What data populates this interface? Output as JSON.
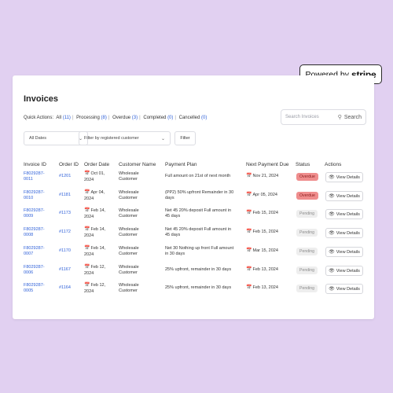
{
  "badge": {
    "prefix": "Powered by",
    "brand": "stripe"
  },
  "page": {
    "title": "Invoices"
  },
  "quick_actions": {
    "label": "Quick Actions:",
    "items": [
      {
        "name": "All",
        "count": "(11)"
      },
      {
        "name": "Processing",
        "count": "(8)"
      },
      {
        "name": "Overdue",
        "count": "(3)"
      },
      {
        "name": "Completed",
        "count": "(0)"
      },
      {
        "name": "Cancelled",
        "count": "(0)"
      }
    ]
  },
  "search": {
    "placeholder": "Search Invoices",
    "button": "Search"
  },
  "filters": {
    "dates": "All Dates",
    "customer": "Filter by registered customer",
    "button": "Filter"
  },
  "table": {
    "headers": [
      "Invoice ID",
      "Order ID",
      "Order Date",
      "Customer Name",
      "Payment Plan",
      "Next Payment Due",
      "Status",
      "Actions"
    ],
    "rows": [
      {
        "invoice_1": "F8029287-",
        "invoice_2": "0011",
        "order": "#1201",
        "date_1": "Oct 01,",
        "date_2": "2024",
        "cust_1": "Wholesale",
        "cust_2": "Customer",
        "plan_1": "Full amount on 21st of next month",
        "plan_2": "",
        "due": "Nov 21, 2024",
        "status": "Overdue",
        "status_type": "overdue",
        "action": "View Details"
      },
      {
        "invoice_1": "F8029287-",
        "invoice_2": "0010",
        "order": "#1181",
        "date_1": "Apr 04,",
        "date_2": "2024",
        "cust_1": "Wholesale",
        "cust_2": "Customer",
        "plan_1": "(PP2) 50% upfront Remainder in 30",
        "plan_2": "days",
        "due": "Apr 05, 2024",
        "status": "Overdue",
        "status_type": "overdue",
        "action": "View Details"
      },
      {
        "invoice_1": "F8029287-",
        "invoice_2": "0009",
        "order": "#1173",
        "date_1": "Feb 14,",
        "date_2": "2024",
        "cust_1": "Wholesale",
        "cust_2": "Customer",
        "plan_1": "Net 45 20% deposit Full amount in",
        "plan_2": "45 days",
        "due": "Feb 15, 2024",
        "status": "Pending",
        "status_type": "pending",
        "action": "View Details"
      },
      {
        "invoice_1": "F8029287-",
        "invoice_2": "0008",
        "order": "#1172",
        "date_1": "Feb 14,",
        "date_2": "2024",
        "cust_1": "Wholesale",
        "cust_2": "Customer",
        "plan_1": "Net 45 20% deposit Full amount in",
        "plan_2": "45 days",
        "due": "Feb 15, 2024",
        "status": "Pending",
        "status_type": "pending",
        "action": "View Details"
      },
      {
        "invoice_1": "F8029287-",
        "invoice_2": "0007",
        "order": "#1170",
        "date_1": "Feb 14,",
        "date_2": "2024",
        "cust_1": "Wholesale",
        "cust_2": "Customer",
        "plan_1": "Net 30 Nothing up front Full amount",
        "plan_2": "in 30 days",
        "due": "Mar 15, 2024",
        "status": "Pending",
        "status_type": "pending",
        "action": "View Details"
      },
      {
        "invoice_1": "F8029287-",
        "invoice_2": "0006",
        "order": "#1167",
        "date_1": "Feb 12,",
        "date_2": "2024",
        "cust_1": "Wholesale",
        "cust_2": "Customer",
        "plan_1": "25% upfront, remainder in 30 days",
        "plan_2": "",
        "due": "Feb 13, 2024",
        "status": "Pending",
        "status_type": "pending",
        "action": "View Details"
      },
      {
        "invoice_1": "F8029287-",
        "invoice_2": "0005",
        "order": "#1164",
        "date_1": "Feb 12,",
        "date_2": "2024",
        "cust_1": "Wholesale",
        "cust_2": "Customer",
        "plan_1": "25% upfront, remainder in 30 days",
        "plan_2": "",
        "due": "Feb 13, 2024",
        "status": "Pending",
        "status_type": "pending",
        "action": "View Details"
      }
    ]
  },
  "colors": {
    "background": "#e1d0f1",
    "link": "#2d5fd8",
    "overdue": "#ef8d8d",
    "pending": "#eeeeee"
  },
  "icons": {
    "calendar": "calendar-icon",
    "eye": "eye-icon",
    "search": "search-icon",
    "chevron": "chevron-down-icon"
  }
}
